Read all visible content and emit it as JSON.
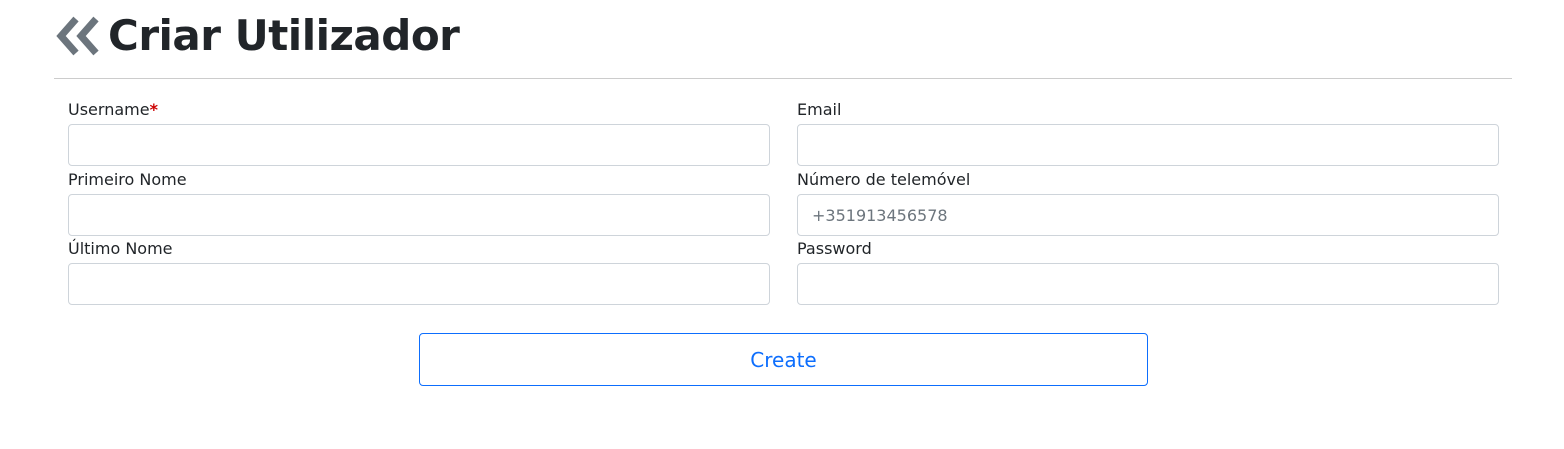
{
  "header": {
    "back_icon": "double-chevron-left-icon",
    "title": "Criar Utilizador"
  },
  "form": {
    "username": {
      "label": "Username",
      "required_mark": "*",
      "value": "",
      "placeholder": ""
    },
    "email": {
      "label": "Email",
      "value": "",
      "placeholder": ""
    },
    "first_name": {
      "label": "Primeiro Nome",
      "value": "",
      "placeholder": ""
    },
    "phone": {
      "label": "Número de telemóvel",
      "value": "",
      "placeholder": "+351913456578"
    },
    "last_name": {
      "label": "Último Nome",
      "value": "",
      "placeholder": ""
    },
    "password": {
      "label": "Password",
      "value": "",
      "placeholder": ""
    },
    "create_label": "Create"
  },
  "colors": {
    "accent": "#0d6efd",
    "required": "#cc0000",
    "back_icon": "#6c757d",
    "input_border": "#ced4da"
  }
}
